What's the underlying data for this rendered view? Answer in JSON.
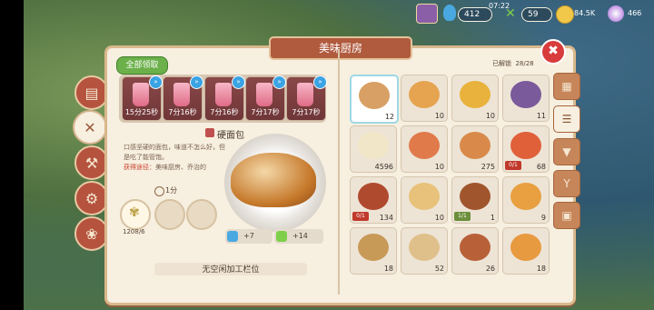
{
  "status": {
    "time": "07:22",
    "energy_value": "412",
    "tools_value": "59",
    "coins_value": "84.5K",
    "gems_value": "466"
  },
  "panel_title": "美味厨房",
  "claim_all_label": "全部领取",
  "queue": [
    {
      "time": "15分25秒"
    },
    {
      "time": "7分16秒"
    },
    {
      "time": "7分16秒"
    },
    {
      "time": "7分17秒"
    },
    {
      "time": "7分17秒"
    }
  ],
  "item": {
    "name": "硬面包",
    "description": "口感坚硬的面包，味道不怎么好，但是吃了能管饱。",
    "source_label": "获得途径：",
    "source_text": "美味厨房、乔治的",
    "cook_time": "1分",
    "ingredient_count": "1208/6",
    "bonus_energy": "+7",
    "bonus_tools": "+14"
  },
  "no_slot_text": "无空闲加工栏位",
  "unlocked_label": "已解锁",
  "unlocked_count": "28/28",
  "recipes": [
    {
      "count": "12",
      "color": "#d8a064",
      "badge": ""
    },
    {
      "count": "10",
      "color": "#e6a450",
      "badge": ""
    },
    {
      "count": "10",
      "color": "#e8b23c",
      "badge": ""
    },
    {
      "count": "11",
      "color": "#7a5a9a",
      "badge": ""
    },
    {
      "count": "4596",
      "color": "#f2e6c8",
      "badge": ""
    },
    {
      "count": "10",
      "color": "#e07a4a",
      "badge": ""
    },
    {
      "count": "275",
      "color": "#d98a4a",
      "badge": ""
    },
    {
      "count": "68",
      "color": "#e0603a",
      "badge": "0/1"
    },
    {
      "count": "134",
      "color": "#b04a2e",
      "badge": "0/1"
    },
    {
      "count": "10",
      "color": "#e8c27a",
      "badge": ""
    },
    {
      "count": "1",
      "color": "#a0552c",
      "badge": "1/1"
    },
    {
      "count": "9",
      "color": "#e8a040",
      "badge": ""
    },
    {
      "count": "18",
      "color": "#c89a58",
      "badge": ""
    },
    {
      "count": "52",
      "color": "#e0c08a",
      "badge": ""
    },
    {
      "count": "26",
      "color": "#b86038",
      "badge": ""
    },
    {
      "count": "18",
      "color": "#e89a40",
      "badge": ""
    }
  ]
}
